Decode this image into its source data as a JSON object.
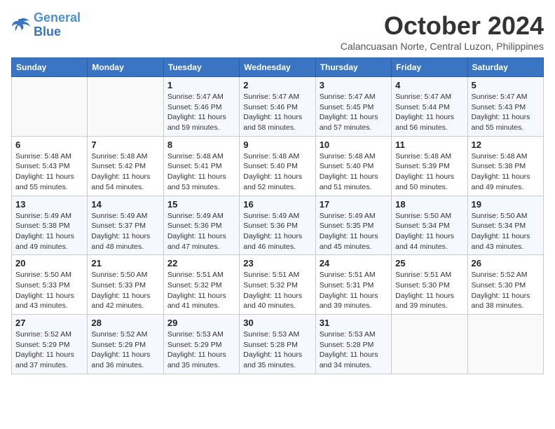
{
  "header": {
    "logo_line1": "General",
    "logo_line2": "Blue",
    "month": "October 2024",
    "location": "Calancuasan Norte, Central Luzon, Philippines"
  },
  "columns": [
    "Sunday",
    "Monday",
    "Tuesday",
    "Wednesday",
    "Thursday",
    "Friday",
    "Saturday"
  ],
  "weeks": [
    [
      {
        "day": "",
        "info": ""
      },
      {
        "day": "",
        "info": ""
      },
      {
        "day": "1",
        "info": "Sunrise: 5:47 AM\nSunset: 5:46 PM\nDaylight: 11 hours and 59 minutes."
      },
      {
        "day": "2",
        "info": "Sunrise: 5:47 AM\nSunset: 5:46 PM\nDaylight: 11 hours and 58 minutes."
      },
      {
        "day": "3",
        "info": "Sunrise: 5:47 AM\nSunset: 5:45 PM\nDaylight: 11 hours and 57 minutes."
      },
      {
        "day": "4",
        "info": "Sunrise: 5:47 AM\nSunset: 5:44 PM\nDaylight: 11 hours and 56 minutes."
      },
      {
        "day": "5",
        "info": "Sunrise: 5:47 AM\nSunset: 5:43 PM\nDaylight: 11 hours and 55 minutes."
      }
    ],
    [
      {
        "day": "6",
        "info": "Sunrise: 5:48 AM\nSunset: 5:43 PM\nDaylight: 11 hours and 55 minutes."
      },
      {
        "day": "7",
        "info": "Sunrise: 5:48 AM\nSunset: 5:42 PM\nDaylight: 11 hours and 54 minutes."
      },
      {
        "day": "8",
        "info": "Sunrise: 5:48 AM\nSunset: 5:41 PM\nDaylight: 11 hours and 53 minutes."
      },
      {
        "day": "9",
        "info": "Sunrise: 5:48 AM\nSunset: 5:40 PM\nDaylight: 11 hours and 52 minutes."
      },
      {
        "day": "10",
        "info": "Sunrise: 5:48 AM\nSunset: 5:40 PM\nDaylight: 11 hours and 51 minutes."
      },
      {
        "day": "11",
        "info": "Sunrise: 5:48 AM\nSunset: 5:39 PM\nDaylight: 11 hours and 50 minutes."
      },
      {
        "day": "12",
        "info": "Sunrise: 5:48 AM\nSunset: 5:38 PM\nDaylight: 11 hours and 49 minutes."
      }
    ],
    [
      {
        "day": "13",
        "info": "Sunrise: 5:49 AM\nSunset: 5:38 PM\nDaylight: 11 hours and 49 minutes."
      },
      {
        "day": "14",
        "info": "Sunrise: 5:49 AM\nSunset: 5:37 PM\nDaylight: 11 hours and 48 minutes."
      },
      {
        "day": "15",
        "info": "Sunrise: 5:49 AM\nSunset: 5:36 PM\nDaylight: 11 hours and 47 minutes."
      },
      {
        "day": "16",
        "info": "Sunrise: 5:49 AM\nSunset: 5:36 PM\nDaylight: 11 hours and 46 minutes."
      },
      {
        "day": "17",
        "info": "Sunrise: 5:49 AM\nSunset: 5:35 PM\nDaylight: 11 hours and 45 minutes."
      },
      {
        "day": "18",
        "info": "Sunrise: 5:50 AM\nSunset: 5:34 PM\nDaylight: 11 hours and 44 minutes."
      },
      {
        "day": "19",
        "info": "Sunrise: 5:50 AM\nSunset: 5:34 PM\nDaylight: 11 hours and 43 minutes."
      }
    ],
    [
      {
        "day": "20",
        "info": "Sunrise: 5:50 AM\nSunset: 5:33 PM\nDaylight: 11 hours and 43 minutes."
      },
      {
        "day": "21",
        "info": "Sunrise: 5:50 AM\nSunset: 5:33 PM\nDaylight: 11 hours and 42 minutes."
      },
      {
        "day": "22",
        "info": "Sunrise: 5:51 AM\nSunset: 5:32 PM\nDaylight: 11 hours and 41 minutes."
      },
      {
        "day": "23",
        "info": "Sunrise: 5:51 AM\nSunset: 5:32 PM\nDaylight: 11 hours and 40 minutes."
      },
      {
        "day": "24",
        "info": "Sunrise: 5:51 AM\nSunset: 5:31 PM\nDaylight: 11 hours and 39 minutes."
      },
      {
        "day": "25",
        "info": "Sunrise: 5:51 AM\nSunset: 5:30 PM\nDaylight: 11 hours and 39 minutes."
      },
      {
        "day": "26",
        "info": "Sunrise: 5:52 AM\nSunset: 5:30 PM\nDaylight: 11 hours and 38 minutes."
      }
    ],
    [
      {
        "day": "27",
        "info": "Sunrise: 5:52 AM\nSunset: 5:29 PM\nDaylight: 11 hours and 37 minutes."
      },
      {
        "day": "28",
        "info": "Sunrise: 5:52 AM\nSunset: 5:29 PM\nDaylight: 11 hours and 36 minutes."
      },
      {
        "day": "29",
        "info": "Sunrise: 5:53 AM\nSunset: 5:29 PM\nDaylight: 11 hours and 35 minutes."
      },
      {
        "day": "30",
        "info": "Sunrise: 5:53 AM\nSunset: 5:28 PM\nDaylight: 11 hours and 35 minutes."
      },
      {
        "day": "31",
        "info": "Sunrise: 5:53 AM\nSunset: 5:28 PM\nDaylight: 11 hours and 34 minutes."
      },
      {
        "day": "",
        "info": ""
      },
      {
        "day": "",
        "info": ""
      }
    ]
  ]
}
